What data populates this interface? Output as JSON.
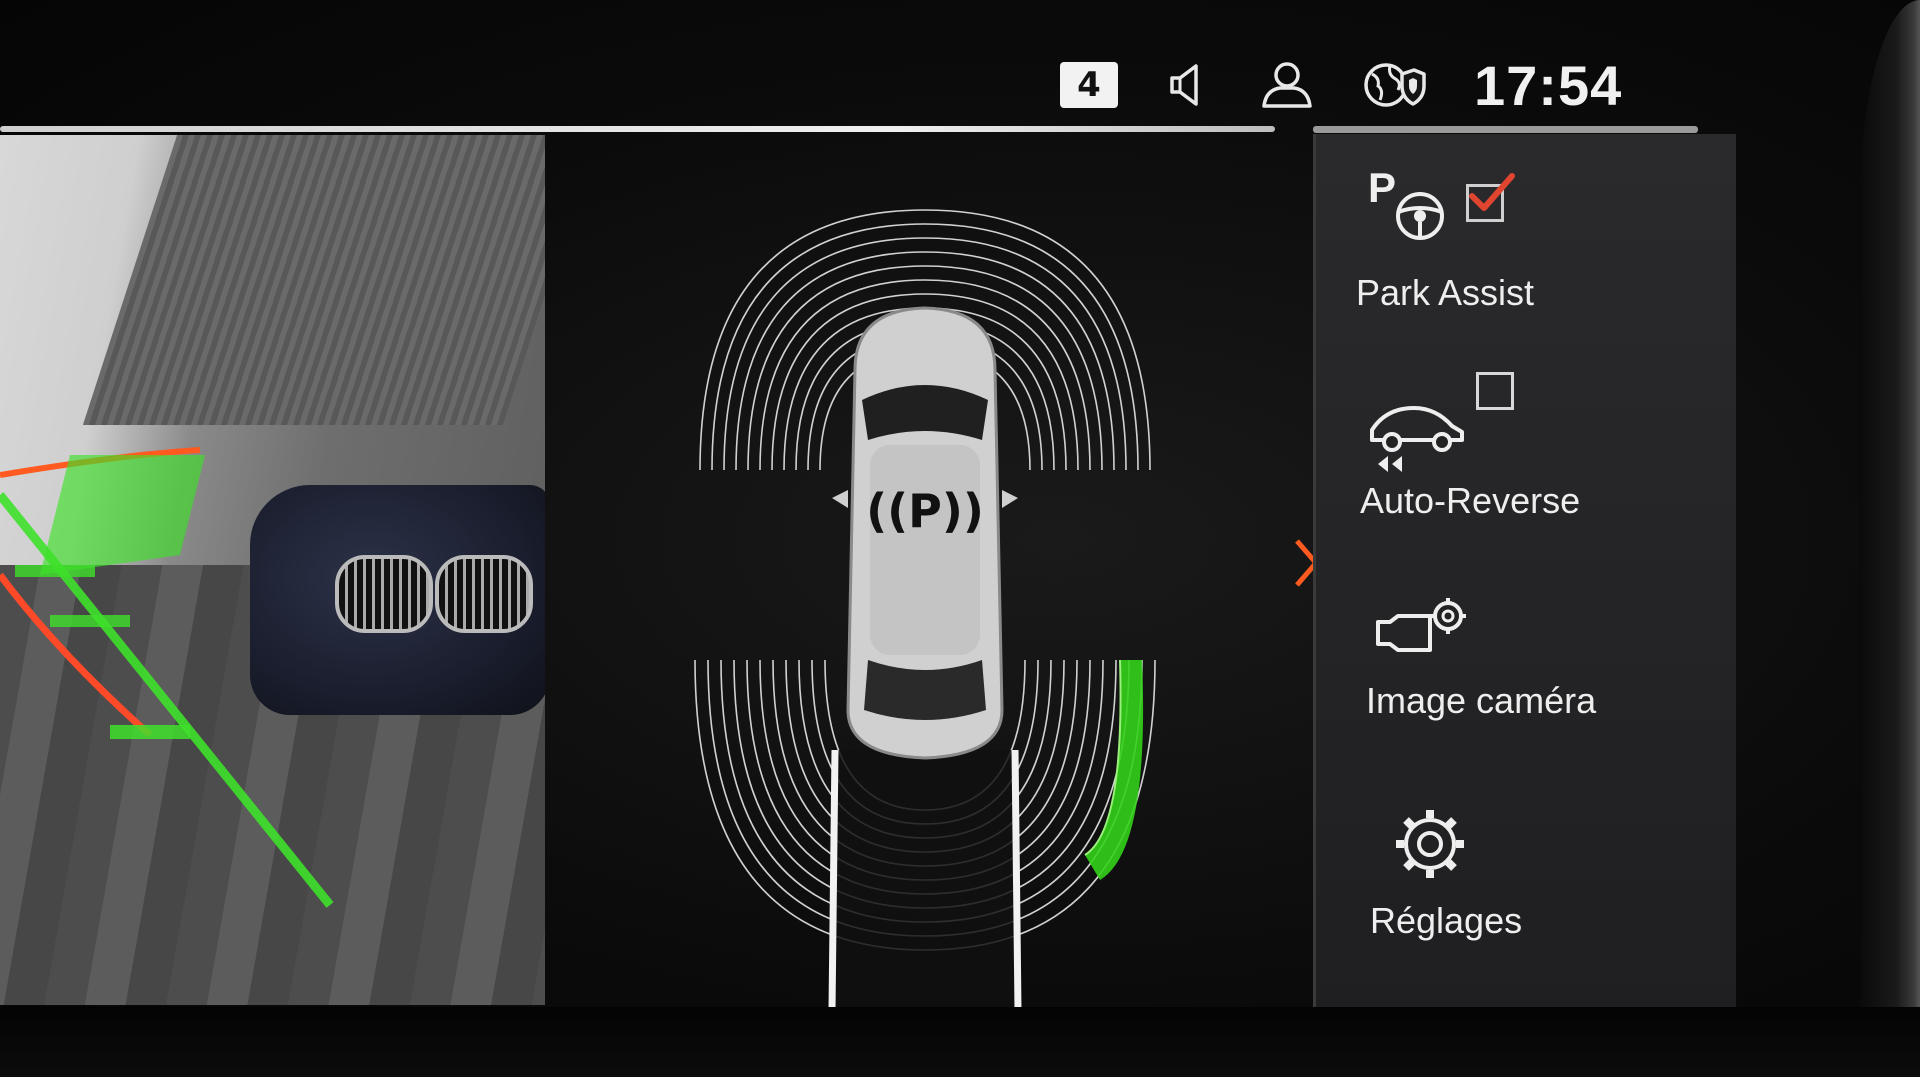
{
  "status_bar": {
    "badge_value": "4",
    "clock": "17:54"
  },
  "menu": {
    "items": [
      {
        "label": "Park Assist",
        "icon": "park-assist-icon",
        "checked": true
      },
      {
        "label": "Auto-Reverse",
        "icon": "auto-reverse-icon",
        "checked": false
      },
      {
        "label": "Image caméra",
        "icon": "camera-settings-icon"
      },
      {
        "label": "Réglages",
        "icon": "gear-icon"
      }
    ]
  },
  "radar": {
    "center_symbol": "P",
    "active_zone": "rear-right",
    "active_color": "#33d11a"
  },
  "colors": {
    "accent": "#ff5a1f",
    "check": "#e0452f",
    "guide_green": "#3ee02a",
    "guide_red": "#ff4a2a"
  }
}
